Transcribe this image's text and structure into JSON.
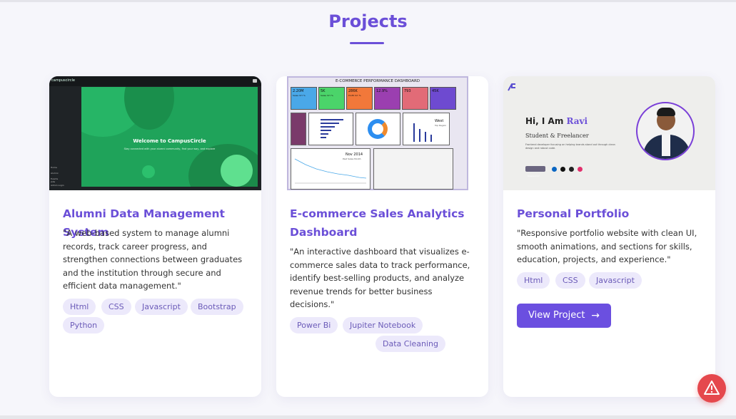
{
  "section": {
    "title": "Projects"
  },
  "projects": [
    {
      "title": "Alumni Data Management System",
      "description": "\"A web-based system to manage alumni records, track career progress, and strengthen connections between graduates and the institution through secure and efficient data management.\"",
      "tags": [
        "Html",
        "CSS",
        "Javascript",
        "Bootstrap",
        "Python"
      ],
      "thumbnail": {
        "logo": "campuscircle",
        "welcome": "Welcome to CampusCircle",
        "subtitle": "Stay connected with your alumni community, find your way, and explore",
        "sidebar": [
          "Home",
          "Alumni",
          "Events",
          "Jobs",
          "Admin Login"
        ]
      }
    },
    {
      "title": "E-commerce Sales Analytics Dashboard",
      "description": "\"An interactive dashboard that visualizes e-commerce sales data to track performance, identify best-selling products, and analyze revenue trends for better business decisions.\"",
      "tags": [
        "Power Bi",
        "Jupiter Notebook",
        "Data Cleaning"
      ],
      "thumbnail": {
        "title": "E-COMMERCE PERFORMANCE DASHBOARD",
        "kpis": [
          {
            "value": "2.20M",
            "note": "Sales YoY %",
            "color": "#4aa8e8"
          },
          {
            "value": "5K",
            "note": "Sales YoY %",
            "color": "#4bd46a"
          },
          {
            "value": "286K",
            "note": "Profit YoY %",
            "color": "#f2783a"
          },
          {
            "value": "12.9%",
            "note": "",
            "color": "#9b3fb0"
          },
          {
            "value": "793",
            "note": "",
            "color": "#e26b77"
          },
          {
            "value": "45K",
            "note": "",
            "color": "#6e4ad0"
          }
        ],
        "panel_month": "Nov 2014",
        "panel_month_sub": "Past Sales Month",
        "panel_region": "West",
        "panel_region_sub": "Top Region"
      }
    },
    {
      "title": "Personal Portfolio",
      "description": "\"Responsive portfolio website with clean UI, smooth animations, and sections for skills, education, projects, and experience.\"",
      "tags": [
        "Html",
        "CSS",
        "Javascript"
      ],
      "button": "View Project",
      "thumbnail": {
        "greeting": "Hi, I Am",
        "name": "Ravi",
        "role": "Student & Freelancer",
        "blurb": "Frontend developer focusing on helping brands stand out through clean design and robust code.",
        "cv_label": "Download CV"
      }
    }
  ],
  "colors": {
    "accent": "#6b4fd8",
    "tag_bg": "#ece9fb",
    "alert": "#e5484d"
  },
  "icons": {
    "alert": "warning-icon",
    "button_arrow": "arrow-right-icon"
  }
}
